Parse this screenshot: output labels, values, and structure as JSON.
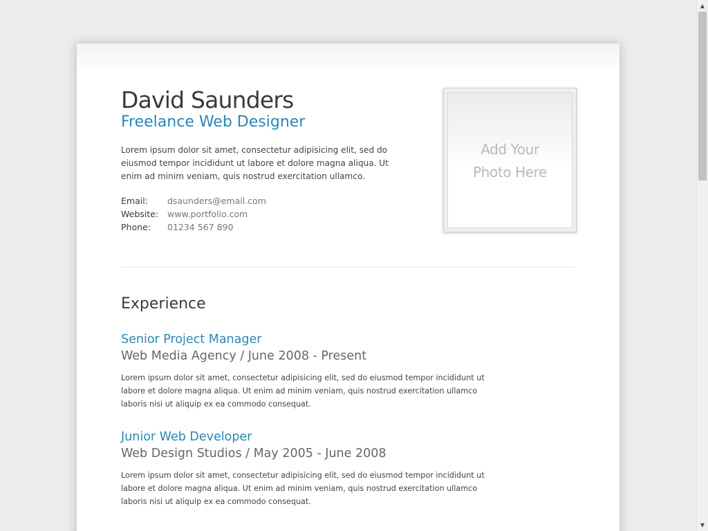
{
  "profile": {
    "name": "David Saunders",
    "title": "Freelance Web Designer",
    "intro": "Lorem ipsum dolor sit amet, consectetur adipisicing elit, sed do eiusmod tempor incididunt ut labore et dolore magna aliqua. Ut enim ad minim veniam, quis nostrud exercitation ullamco.",
    "contacts": [
      {
        "label": "Email:",
        "value": "dsaunders@email.com"
      },
      {
        "label": "Website:",
        "value": "www.portfolio.com"
      },
      {
        "label": "Phone:",
        "value": "01234 567 890"
      }
    ],
    "photo_placeholder": {
      "line1": "Add Your",
      "line2": "Photo Here"
    }
  },
  "experience": {
    "section_title": "Experience",
    "jobs": [
      {
        "role": "Senior Project Manager",
        "company": "Web Media Agency / June 2008 - Present",
        "description": "Lorem ipsum dolor sit amet, consectetur adipisicing elit, sed do eiusmod tempor incididunt ut labore et dolore magna aliqua. Ut enim ad minim veniam, quis nostrud exercitation ullamco laboris nisi ut aliquip ex ea commodo consequat."
      },
      {
        "role": "Junior Web Developer",
        "company": "Web Design Studios / May 2005 - June 2008",
        "description": "Lorem ipsum dolor sit amet, consectetur adipisicing elit, sed do eiusmod tempor incididunt ut labore et dolore magna aliqua. Ut enim ad minim veniam, quis nostrud exercitation ullamco laboris nisi ut aliquip ex ea commodo consequat."
      }
    ]
  },
  "scrollbar": {
    "up_icon": "▲",
    "down_icon": "▼",
    "thumb_position": 0
  },
  "colors": {
    "accent": "#2b86b5",
    "text": "#3a3a3a",
    "muted": "#777777",
    "page_background": "#ececec"
  }
}
